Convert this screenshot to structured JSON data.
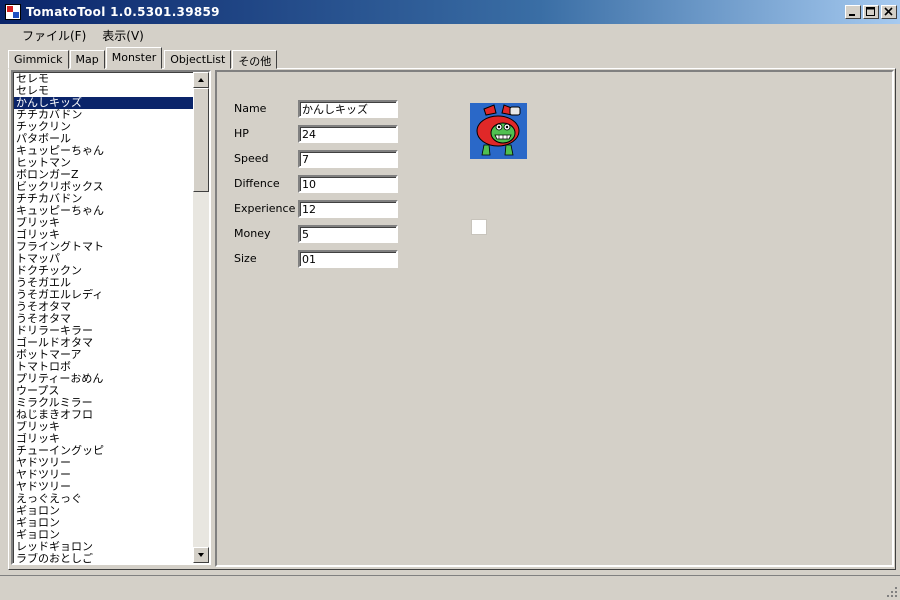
{
  "window": {
    "title": "TomatoTool  1.0.5301.39859"
  },
  "menu": {
    "items": [
      "ファイル(F)",
      "表示(V)"
    ]
  },
  "tabs": [
    "Gimmick",
    "Map",
    "Monster",
    "ObjectList",
    "その他"
  ],
  "active_tab": "Monster",
  "monster_list": {
    "selected_index": 2,
    "items": [
      "セレモ",
      "セレモ",
      "かんしキッズ",
      "チチカバドン",
      "チックリン",
      "パタボール",
      "キュッピーちゃん",
      "ヒットマン",
      "ボロンガーZ",
      "ビックリボックス",
      "チチカバドン",
      "キュッピーちゃん",
      "ブリッキ",
      "ゴリッキ",
      "フライングトマト",
      "トマッパ",
      "ドクチックン",
      "うそガエル",
      "うそガエルレディ",
      "うそオタマ",
      "うそオタマ",
      "ドリラーキラー",
      "ゴールドオタマ",
      "ボットマーア",
      "トマトロボ",
      "プリティーおめん",
      "ウープス",
      "ミラクルミラー",
      "ねじまきオフロ",
      "ブリッキ",
      "ゴリッキ",
      "チューイングッピ",
      "ヤドツリー",
      "ヤドツリー",
      "ヤドツリー",
      "えっぐえっぐ",
      "ギョロン",
      "ギョロン",
      "ギョロン",
      "レッドギョロン",
      "ラブのおとしご"
    ]
  },
  "fields": [
    {
      "label": "Name",
      "value": "かんしキッズ"
    },
    {
      "label": "HP",
      "value": "24"
    },
    {
      "label": "Speed",
      "value": "7"
    },
    {
      "label": "Diffence",
      "value": "10"
    },
    {
      "label": "Experience",
      "value": "12"
    },
    {
      "label": "Money",
      "value": "5"
    },
    {
      "label": "Size",
      "value": "01"
    }
  ],
  "colors": {
    "selection": "#0a246a",
    "window_bg": "#d4d0c8",
    "sprite_bg": "#2a68c8",
    "sprite_body": "#e02828",
    "sprite_belly": "#50c050"
  },
  "icons": {
    "app": "app-icon",
    "minimize": "minimize-icon",
    "maximize": "maximize-icon",
    "close": "close-icon",
    "scroll_up": "scroll-up-arrow-icon",
    "scroll_down": "scroll-down-arrow-icon",
    "grip": "size-grip-icon"
  }
}
